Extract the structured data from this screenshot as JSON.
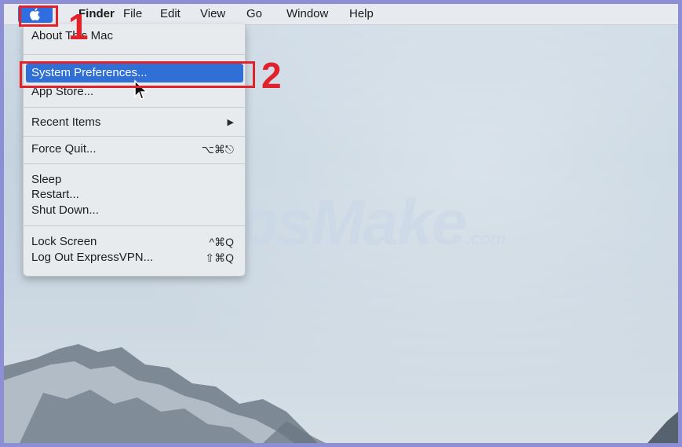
{
  "menubar": {
    "app_name": "Finder",
    "items": [
      "File",
      "Edit",
      "View",
      "Go",
      "Window",
      "Help"
    ]
  },
  "apple_menu": {
    "about": "About This Mac",
    "system_preferences": "System Preferences...",
    "app_store": "App Store...",
    "recent_items": "Recent Items",
    "recent_items_arrow": "▶",
    "force_quit": "Force Quit...",
    "force_quit_shortcut": "⌥⌘⎋",
    "sleep": "Sleep",
    "restart": "Restart...",
    "shut_down": "Shut Down...",
    "lock_screen": "Lock Screen",
    "lock_screen_shortcut": "^⌘Q",
    "log_out": "Log Out ExpressVPN...",
    "log_out_shortcut": "⇧⌘Q"
  },
  "annotations": {
    "step1": "1",
    "step2": "2"
  },
  "watermark": {
    "main": "TipsMake",
    "suffix": ".com"
  },
  "colors": {
    "annotation_red": "#e2222b",
    "highlight_blue": "#2f6fd6",
    "frame_border": "#8d8fd6"
  }
}
